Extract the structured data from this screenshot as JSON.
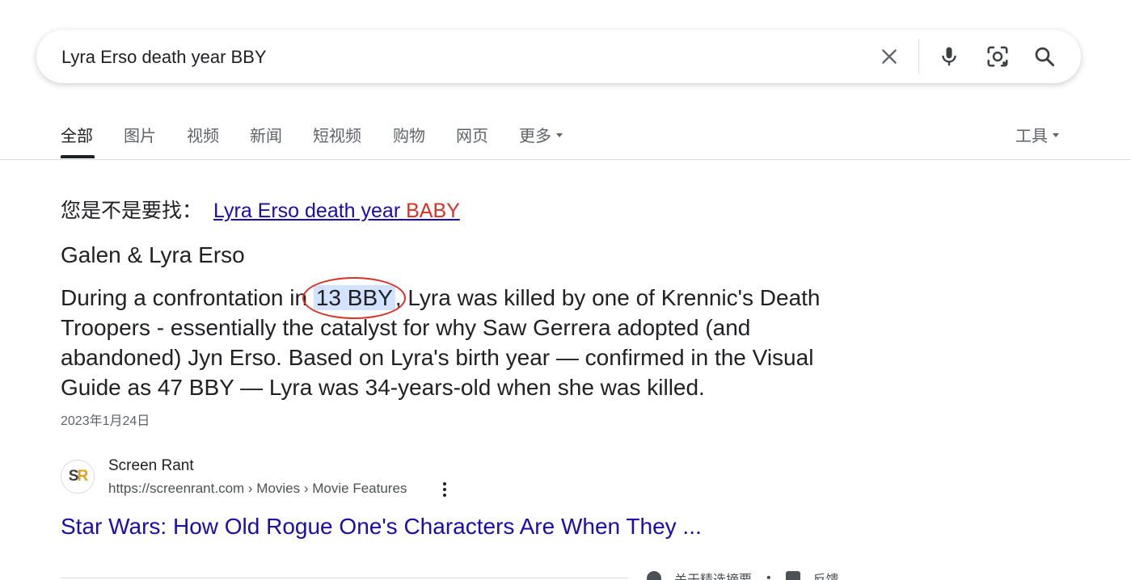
{
  "search": {
    "query": "Lyra Erso death year BBY",
    "icons": [
      "close-icon",
      "mic-icon",
      "lens-icon",
      "search-icon"
    ]
  },
  "tabs": [
    {
      "label": "全部",
      "active": true
    },
    {
      "label": "图片"
    },
    {
      "label": "视频"
    },
    {
      "label": "新闻"
    },
    {
      "label": "短视频"
    },
    {
      "label": "购物"
    },
    {
      "label": "网页"
    },
    {
      "label": "更多"
    }
  ],
  "tools_label": "工具",
  "did_you_mean": {
    "prefix": "您是不是要找：",
    "link_plain": "Lyra Erso death year ",
    "link_correction": "BABY"
  },
  "snippet": {
    "title": "Galen & Lyra Erso",
    "body_before": "During a confrontation in ",
    "highlight": "13 BBY",
    "body_after": ", Lyra was killed by one of Krennic's Death Troopers - essentially the catalyst for why Saw Gerrera adopted (and abandoned) Jyn Erso. Based on Lyra's birth year — confirmed in the Visual Guide as 47 BBY — Lyra was 34-years-old when she was killed.",
    "date": "2023年1月24日"
  },
  "source": {
    "logo_s": "S",
    "logo_r": "R",
    "name": "Screen Rant",
    "url": "https://screenrant.com › Movies › Movie Features",
    "result_title": "Star Wars: How Old Rogue One's Characters Are When They ..."
  },
  "footer": {
    "about": "关于精选摘要",
    "separator": "•",
    "feedback": "反馈"
  },
  "colors": {
    "link": "#1a0dab",
    "correction": "#d93025",
    "highlight": "#d3e3fd",
    "annotation": "#d93025"
  }
}
